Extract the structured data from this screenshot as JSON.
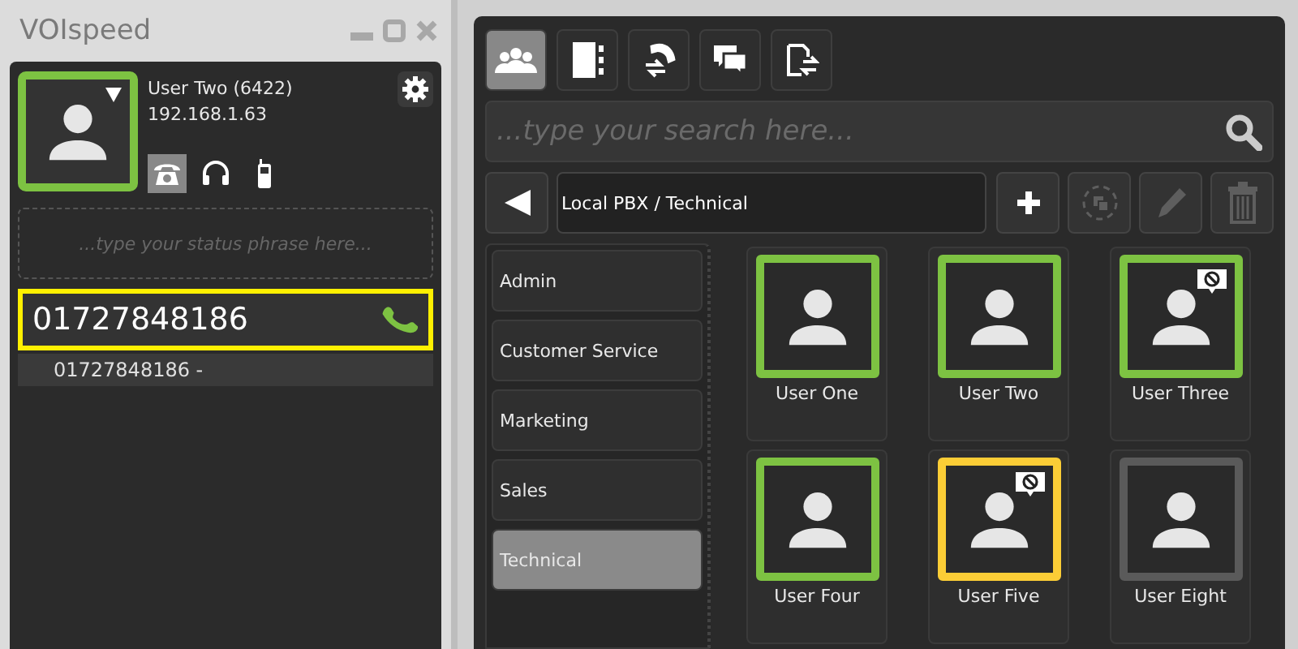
{
  "app_title": "VOIspeed",
  "profile": {
    "name": "User Two (6422)",
    "address": "192.168.1.63",
    "color": "#7dc242"
  },
  "devices": [
    {
      "kind": "deskphone",
      "selected": true
    },
    {
      "kind": "headset",
      "selected": false
    },
    {
      "kind": "mobile",
      "selected": false
    }
  ],
  "status_field": {
    "placeholder": "...type your status phrase here..."
  },
  "dial_field": {
    "value": "01727848186"
  },
  "suggestions": [
    "01727848186 -"
  ],
  "tabs": [
    {
      "kind": "contacts",
      "selected": true
    },
    {
      "kind": "phonebook",
      "selected": false
    },
    {
      "kind": "calls",
      "selected": false
    },
    {
      "kind": "chat",
      "selected": false
    },
    {
      "kind": "files",
      "selected": false
    }
  ],
  "search": {
    "placeholder": "...type your search here..."
  },
  "breadcrumb": "Local PBX / Technical",
  "toolbar": [
    {
      "kind": "add",
      "disabled": false
    },
    {
      "kind": "group",
      "disabled": true
    },
    {
      "kind": "edit",
      "disabled": true
    },
    {
      "kind": "delete",
      "disabled": true
    }
  ],
  "groups": [
    {
      "label": "Admin",
      "selected": false
    },
    {
      "label": "Customer Service",
      "selected": false
    },
    {
      "label": "Marketing",
      "selected": false
    },
    {
      "label": "Sales",
      "selected": false
    },
    {
      "label": "Technical",
      "selected": true
    }
  ],
  "contacts": [
    {
      "name": "User One",
      "color": "#7dc242",
      "do_not_disturb": false
    },
    {
      "name": "User Two",
      "color": "#7dc242",
      "do_not_disturb": false
    },
    {
      "name": "User Three",
      "color": "#7dc242",
      "do_not_disturb": true
    },
    {
      "name": "User Four",
      "color": "#7dc242",
      "do_not_disturb": false
    },
    {
      "name": "User Five",
      "color": "#fbcd36",
      "do_not_disturb": true
    },
    {
      "name": "User Eight",
      "color": "#5a5a5a",
      "do_not_disturb": false
    }
  ]
}
